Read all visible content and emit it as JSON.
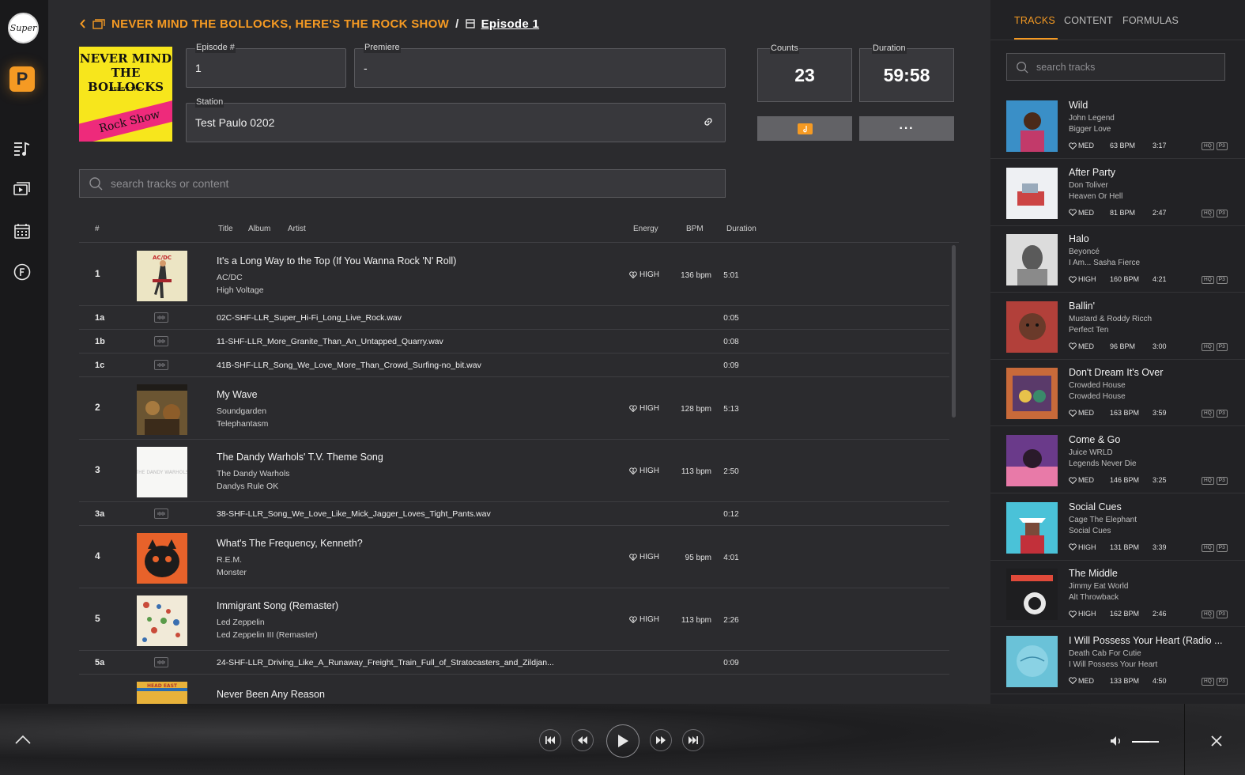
{
  "rail": {
    "logo_text": "Super",
    "brand_letter": "P"
  },
  "breadcrumb": {
    "show": "NEVER MIND THE BOLLOCKS, HERE'S THE ROCK SHOW",
    "separator": "/",
    "episode": "Episode 1"
  },
  "cover": {
    "line1": "NEVER MIND",
    "line2": "THE BOLLOCKS",
    "line3": "HERE'S THE",
    "band": "Rock Show"
  },
  "fields": {
    "episode_label": "Episode #",
    "episode_value": "1",
    "premiere_label": "Premiere",
    "premiere_value": "-",
    "station_label": "Station",
    "station_value": "Test Paulo 0202"
  },
  "stats": {
    "counts_label": "Counts",
    "counts_value": "23",
    "duration_label": "Duration",
    "duration_value": "59:58",
    "more_label": "···"
  },
  "search": {
    "placeholder": "search tracks or content"
  },
  "table": {
    "headers": {
      "num": "#",
      "title": "Title",
      "album": "Album",
      "artist": "Artist",
      "energy": "Energy",
      "bpm": "BPM",
      "duration": "Duration"
    },
    "rows": [
      {
        "num": "1",
        "title": "It's a Long Way to the Top (If You Wanna Rock 'N' Roll)",
        "artist": "AC/DC",
        "album": "High Voltage",
        "energy": "HIGH",
        "bpm": "136 bpm",
        "duration": "5:01"
      },
      {
        "num": "1a",
        "file": "02C-SHF-LLR_Super_Hi-Fi_Long_Live_Rock.wav",
        "duration": "0:05"
      },
      {
        "num": "1b",
        "file": "11-SHF-LLR_More_Granite_Than_An_Untapped_Quarry.wav",
        "duration": "0:08"
      },
      {
        "num": "1c",
        "file": "41B-SHF-LLR_Song_We_Love_More_Than_Crowd_Surfing-no_bit.wav",
        "duration": "0:09"
      },
      {
        "num": "2",
        "title": "My Wave",
        "artist": "Soundgarden",
        "album": "Telephantasm",
        "energy": "HIGH",
        "bpm": "128 bpm",
        "duration": "5:13"
      },
      {
        "num": "3",
        "title": "The Dandy Warhols' T.V. Theme Song",
        "artist": "The Dandy Warhols",
        "album": "Dandys Rule OK",
        "energy": "HIGH",
        "bpm": "113 bpm",
        "duration": "2:50"
      },
      {
        "num": "3a",
        "file": "38-SHF-LLR_Song_We_Love_Like_Mick_Jagger_Loves_Tight_Pants.wav",
        "duration": "0:12"
      },
      {
        "num": "4",
        "title": "What's The Frequency, Kenneth?",
        "artist": "R.E.M.",
        "album": "Monster",
        "energy": "HIGH",
        "bpm": "95 bpm",
        "duration": "4:01"
      },
      {
        "num": "5",
        "title": "Immigrant Song (Remaster)",
        "artist": "Led Zeppelin",
        "album": "Led Zeppelin III (Remaster)",
        "energy": "HIGH",
        "bpm": "113 bpm",
        "duration": "2:26"
      },
      {
        "num": "5a",
        "file": "24-SHF-LLR_Driving_Like_A_Runaway_Freight_Train_Full_of_Stratocasters_and_Zildjan...",
        "duration": "0:09"
      },
      {
        "num": "",
        "title": "Never Been Any Reason"
      }
    ]
  },
  "panel": {
    "tabs": [
      "TRACKS",
      "CONTENT",
      "FORMULAS"
    ],
    "search_placeholder": "search tracks",
    "badges": [
      "HQ",
      "P3"
    ],
    "tracks": [
      {
        "title": "Wild",
        "artist": "John Legend",
        "album": "Bigger Love",
        "energy": "MED",
        "bpm": "63 BPM",
        "duration": "3:17"
      },
      {
        "title": "After Party",
        "artist": "Don Toliver",
        "album": "Heaven Or Hell",
        "energy": "MED",
        "bpm": "81 BPM",
        "duration": "2:47"
      },
      {
        "title": "Halo",
        "artist": "Beyoncé",
        "album": "I Am... Sasha Fierce",
        "energy": "HIGH",
        "bpm": "160 BPM",
        "duration": "4:21"
      },
      {
        "title": "Ballin'",
        "artist": "Mustard & Roddy Ricch",
        "album": "Perfect Ten",
        "energy": "MED",
        "bpm": "96 BPM",
        "duration": "3:00"
      },
      {
        "title": "Don't Dream It's Over",
        "artist": "Crowded House",
        "album": "Crowded House",
        "energy": "MED",
        "bpm": "163 BPM",
        "duration": "3:59"
      },
      {
        "title": "Come & Go",
        "artist": "Juice WRLD",
        "album": "Legends Never Die",
        "energy": "MED",
        "bpm": "146 BPM",
        "duration": "3:25"
      },
      {
        "title": "Social Cues",
        "artist": "Cage The Elephant",
        "album": "Social Cues",
        "energy": "HIGH",
        "bpm": "131 BPM",
        "duration": "3:39"
      },
      {
        "title": "The Middle",
        "artist": "Jimmy Eat World",
        "album": "Alt Throwback",
        "energy": "HIGH",
        "bpm": "162 BPM",
        "duration": "2:46"
      },
      {
        "title": "I Will Possess Your Heart (Radio ...",
        "artist": "Death Cab For Cutie",
        "album": "I Will Possess Your Heart",
        "energy": "MED",
        "bpm": "133 BPM",
        "duration": "4:50"
      }
    ]
  },
  "player": {
    "volume_fraction": 0.65
  },
  "colors": {
    "accent": "#f59a23",
    "background": "#2b2b2e",
    "panel": "#222225",
    "rail": "#19191b"
  }
}
